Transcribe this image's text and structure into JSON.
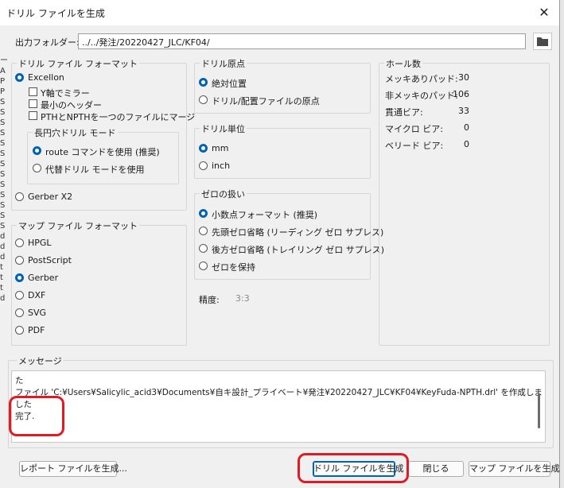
{
  "window": {
    "title": "ドリル ファイルを生成",
    "close": "✕"
  },
  "left_strip_letters": [
    "ー",
    "A",
    "P",
    "P",
    "S",
    "S",
    "S",
    "S",
    "S",
    "S",
    "S",
    "S",
    "S",
    "S",
    "S",
    "S",
    "S",
    "d",
    "d",
    "d",
    "t",
    "t",
    "t",
    "d"
  ],
  "output_folder": {
    "label": "出力フォルダー:",
    "value": "../../発注/20220427_JLC/KF04/"
  },
  "drill_format": {
    "title": "ドリル ファイル フォーマット",
    "excellon": "Excellon",
    "mirror_y": "Y軸でミラー",
    "min_header": "最小のヘッダー",
    "merge_pth_npth": "PTHとNPTHを一つのファイルにマージ",
    "oval_mode": {
      "title": "長円穴ドリル モード",
      "route": "route コマンドを使用 (推奨)",
      "alt": "代替ドリル モードを使用"
    },
    "gerber_x2": "Gerber X2"
  },
  "map_format": {
    "title": "マップ ファイル フォーマット",
    "options": [
      "HPGL",
      "PostScript",
      "Gerber",
      "DXF",
      "SVG",
      "PDF"
    ],
    "selected": "Gerber"
  },
  "drill_origin": {
    "title": "ドリル原点",
    "absolute": "絶対位置",
    "aux": "ドリル/配置ファイルの原点"
  },
  "drill_units": {
    "title": "ドリル単位",
    "mm": "mm",
    "inch": "inch"
  },
  "zeros": {
    "title": "ゼロの扱い",
    "decimal": "小数点フォーマット (推奨)",
    "suppress_leading": "先頭ゼロ省略 (リーディング ゼロ サプレス)",
    "suppress_trailing": "後方ゼロ省略 (トレイリング ゼロ サプレス)",
    "keep": "ゼロを保持"
  },
  "precision": {
    "label": "精度:",
    "value": "3:3"
  },
  "hole_counts": {
    "title": "ホール数",
    "rows": [
      {
        "label": "メッキありパッド:",
        "value": "30"
      },
      {
        "label": "非メッキのパッド:",
        "value": "106"
      },
      {
        "label": "貫通ビア:",
        "value": "33"
      },
      {
        "label": "マイクロ ビア:",
        "value": "0"
      },
      {
        "label": "ベリード ビア:",
        "value": "0"
      }
    ]
  },
  "messages": {
    "title": "メッセージ",
    "lines": [
      "た",
      "ファイル 'C:¥Users¥Salicylic_acid3¥Documents¥自キ設計_プライベート¥発注¥20220427_JLC¥KF04¥KeyFuda-NPTH.drl' を作成しま",
      "した",
      "完了."
    ]
  },
  "buttons": {
    "report": "レポート ファイルを生成...",
    "generate_drill": "ドリル ファイルを生成",
    "close": "閉じる",
    "generate_map": "マップ ファイルを生成"
  },
  "colors": {
    "accent": "#0063b1",
    "annotation": "#e01b24"
  }
}
